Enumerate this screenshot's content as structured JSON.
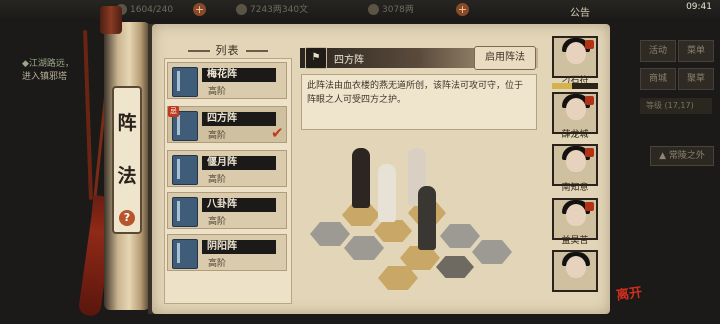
{
  "hud": {
    "res1": "1604/240",
    "res2": "7243两340文",
    "res3": "3078两",
    "announce": "公告",
    "time": "09:41"
  },
  "quest": {
    "line1": "◆江湖路远，",
    "line2": "进入镇邪塔"
  },
  "right_menu": {
    "buttons": [
      "活动",
      "菜单",
      "商城",
      "聚草"
    ],
    "wide": "等级 (17,17)",
    "path": "▲ 常陵之外"
  },
  "panel": {
    "vertical_title": [
      "阵",
      "法"
    ],
    "help": "?",
    "list_title": "列表",
    "items": [
      {
        "name": "梅花阵",
        "rank": "高阶",
        "badge": ""
      },
      {
        "name": "四方阵",
        "rank": "高阶",
        "badge": "忌"
      },
      {
        "name": "偃月阵",
        "rank": "高阶",
        "badge": ""
      },
      {
        "name": "八卦阵",
        "rank": "高阶",
        "badge": ""
      },
      {
        "name": "阴阳阵",
        "rank": "高阶",
        "badge": ""
      }
    ],
    "detail": {
      "name": "四方阵",
      "rank": "高阶",
      "enable_button": "启用阵法",
      "description": "此阵法由血衣楼的燕无道所创，该阵法可攻可守，位于阵眼之人可受四方之护。"
    },
    "party": [
      {
        "name": "刁石符"
      },
      {
        "name": "薛龙城"
      },
      {
        "name": "南知意"
      },
      {
        "name": "益昊苦"
      },
      {
        "name": ""
      }
    ],
    "hp_fraction": 0.44,
    "leave": "离开"
  },
  "colors": {
    "accent": "#c33b18",
    "parchment": "#e3d5b8",
    "book": "#3f5d79"
  }
}
